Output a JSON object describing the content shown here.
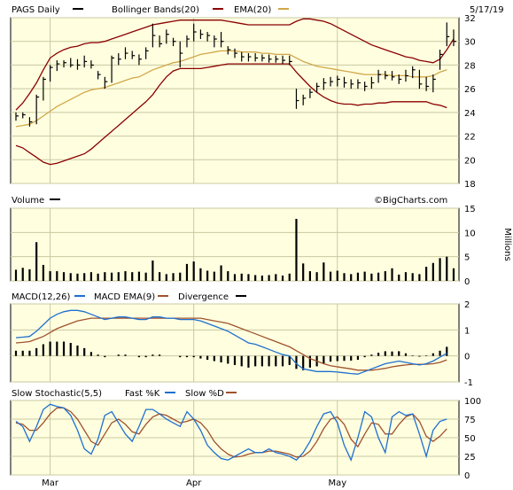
{
  "header": {
    "date": "5/17/19",
    "watermark": "©BigCharts.com"
  },
  "colors": {
    "bg": "#ffffe0",
    "bollinger": "#8b0000",
    "ema": "#d2a648",
    "macd": "#1e6fd0",
    "macd_ema": "#a0522d",
    "fast_k": "#1e6fd0",
    "slow_d": "#a0522d",
    "black": "#000000"
  },
  "x_axis": {
    "labels": [
      "Mar",
      "Apr",
      "May"
    ],
    "label_index": [
      5,
      26,
      47
    ]
  },
  "chart_data": [
    {
      "type": "line",
      "legend": [
        {
          "label": "PAGS Daily",
          "color": "#000000"
        },
        {
          "label": "Bollinger Bands(20)",
          "color": "#8b0000"
        },
        {
          "label": "EMA(20)",
          "color": "#d2a648"
        }
      ],
      "ylim": [
        18,
        32
      ],
      "yticks": [
        18,
        20,
        22,
        24,
        26,
        28,
        30,
        32
      ],
      "price_bars": [
        {
          "h": 24.0,
          "l": 23.3,
          "c": 23.7
        },
        {
          "h": 24.0,
          "l": 23.5,
          "c": 23.8
        },
        {
          "h": 23.6,
          "l": 22.8,
          "c": 23.2
        },
        {
          "h": 25.5,
          "l": 23.0,
          "c": 25.3
        },
        {
          "h": 27.0,
          "l": 25.0,
          "c": 26.8
        },
        {
          "h": 28.0,
          "l": 26.6,
          "c": 27.8
        },
        {
          "h": 28.4,
          "l": 27.5,
          "c": 28.1
        },
        {
          "h": 28.4,
          "l": 27.8,
          "c": 28.2
        },
        {
          "h": 28.6,
          "l": 27.8,
          "c": 28.0
        },
        {
          "h": 28.5,
          "l": 27.6,
          "c": 28.0
        },
        {
          "h": 28.8,
          "l": 27.8,
          "c": 28.3
        },
        {
          "h": 28.4,
          "l": 27.7,
          "c": 28.0
        },
        {
          "h": 27.5,
          "l": 26.8,
          "c": 27.2
        },
        {
          "h": 27.0,
          "l": 26.0,
          "c": 26.6
        },
        {
          "h": 28.8,
          "l": 26.5,
          "c": 28.6
        },
        {
          "h": 29.0,
          "l": 28.0,
          "c": 28.5
        },
        {
          "h": 29.5,
          "l": 28.5,
          "c": 29.0
        },
        {
          "h": 29.2,
          "l": 28.5,
          "c": 28.8
        },
        {
          "h": 28.9,
          "l": 28.0,
          "c": 28.5
        },
        {
          "h": 29.5,
          "l": 28.5,
          "c": 29.2
        },
        {
          "h": 31.5,
          "l": 29.5,
          "c": 30.5
        },
        {
          "h": 30.5,
          "l": 29.5,
          "c": 29.8
        },
        {
          "h": 31.0,
          "l": 29.8,
          "c": 30.6
        },
        {
          "h": 30.3,
          "l": 29.6,
          "c": 30.0
        },
        {
          "h": 30.0,
          "l": 27.8,
          "c": 29.0
        },
        {
          "h": 30.5,
          "l": 29.5,
          "c": 30.2
        },
        {
          "h": 31.5,
          "l": 30.0,
          "c": 30.8
        },
        {
          "h": 31.0,
          "l": 30.2,
          "c": 30.6
        },
        {
          "h": 30.8,
          "l": 30.0,
          "c": 30.5
        },
        {
          "h": 30.5,
          "l": 29.5,
          "c": 30.2
        },
        {
          "h": 30.8,
          "l": 29.5,
          "c": 30.0
        },
        {
          "h": 29.6,
          "l": 28.9,
          "c": 29.3
        },
        {
          "h": 29.4,
          "l": 28.6,
          "c": 29.0
        },
        {
          "h": 29.1,
          "l": 28.3,
          "c": 28.7
        },
        {
          "h": 29.0,
          "l": 28.3,
          "c": 28.7
        },
        {
          "h": 29.0,
          "l": 28.3,
          "c": 28.6
        },
        {
          "h": 28.9,
          "l": 28.3,
          "c": 28.6
        },
        {
          "h": 28.9,
          "l": 28.2,
          "c": 28.5
        },
        {
          "h": 28.8,
          "l": 28.2,
          "c": 28.5
        },
        {
          "h": 28.8,
          "l": 28.1,
          "c": 28.4
        },
        {
          "h": 28.8,
          "l": 28.0,
          "c": 28.3
        },
        {
          "h": 26.0,
          "l": 24.3,
          "c": 25.0
        },
        {
          "h": 25.5,
          "l": 24.6,
          "c": 25.2
        },
        {
          "h": 26.0,
          "l": 25.2,
          "c": 25.7
        },
        {
          "h": 26.5,
          "l": 25.7,
          "c": 26.2
        },
        {
          "h": 26.9,
          "l": 25.9,
          "c": 26.5
        },
        {
          "h": 27.0,
          "l": 26.2,
          "c": 26.6
        },
        {
          "h": 27.1,
          "l": 26.2,
          "c": 26.8
        },
        {
          "h": 27.0,
          "l": 26.1,
          "c": 26.5
        },
        {
          "h": 26.8,
          "l": 26.0,
          "c": 26.4
        },
        {
          "h": 26.8,
          "l": 26.0,
          "c": 26.5
        },
        {
          "h": 26.6,
          "l": 25.8,
          "c": 26.2
        },
        {
          "h": 27.0,
          "l": 26.0,
          "c": 26.5
        },
        {
          "h": 27.6,
          "l": 26.5,
          "c": 27.2
        },
        {
          "h": 27.5,
          "l": 26.8,
          "c": 27.1
        },
        {
          "h": 27.5,
          "l": 26.7,
          "c": 27.0
        },
        {
          "h": 27.2,
          "l": 26.4,
          "c": 26.8
        },
        {
          "h": 27.6,
          "l": 26.6,
          "c": 27.1
        },
        {
          "h": 27.9,
          "l": 26.9,
          "c": 27.6
        },
        {
          "h": 27.6,
          "l": 26.0,
          "c": 26.4
        },
        {
          "h": 27.0,
          "l": 25.8,
          "c": 26.2
        },
        {
          "h": 27.2,
          "l": 25.7,
          "c": 26.8
        },
        {
          "h": 29.3,
          "l": 27.6,
          "c": 28.9
        },
        {
          "h": 31.6,
          "l": 29.6,
          "c": 30.4
        },
        {
          "h": 31.0,
          "l": 29.6,
          "c": 30.0
        }
      ],
      "bollinger_upper": [
        24.2,
        24.8,
        25.6,
        26.5,
        27.6,
        28.6,
        29.0,
        29.3,
        29.5,
        29.6,
        29.8,
        29.9,
        29.9,
        30.0,
        30.2,
        30.4,
        30.6,
        30.8,
        31.0,
        31.2,
        31.4,
        31.5,
        31.6,
        31.7,
        31.8,
        31.8,
        31.8,
        31.8,
        31.8,
        31.8,
        31.8,
        31.7,
        31.6,
        31.5,
        31.4,
        31.4,
        31.4,
        31.4,
        31.4,
        31.4,
        31.4,
        31.7,
        31.9,
        31.9,
        31.8,
        31.7,
        31.5,
        31.2,
        30.9,
        30.6,
        30.3,
        30.0,
        29.7,
        29.5,
        29.3,
        29.1,
        28.9,
        28.7,
        28.6,
        28.4,
        28.3,
        28.2,
        28.5,
        29.3,
        30.2
      ],
      "bollinger_lower": [
        21.2,
        21.0,
        20.6,
        20.2,
        19.8,
        19.6,
        19.7,
        19.9,
        20.1,
        20.3,
        20.5,
        20.9,
        21.4,
        21.9,
        22.4,
        22.9,
        23.4,
        23.9,
        24.4,
        24.9,
        25.5,
        26.3,
        27.0,
        27.5,
        27.7,
        27.7,
        27.7,
        27.7,
        27.8,
        27.9,
        28.0,
        28.1,
        28.1,
        28.1,
        28.1,
        28.1,
        28.1,
        28.1,
        28.1,
        28.1,
        28.1,
        27.4,
        26.8,
        26.2,
        25.7,
        25.3,
        25.0,
        24.8,
        24.7,
        24.7,
        24.6,
        24.7,
        24.7,
        24.8,
        24.8,
        24.9,
        24.9,
        24.9,
        24.9,
        24.9,
        24.9,
        24.7,
        24.6,
        24.4
      ],
      "ema": [
        22.8,
        22.9,
        23.0,
        23.3,
        23.7,
        24.1,
        24.5,
        24.8,
        25.1,
        25.4,
        25.7,
        25.9,
        26.0,
        26.1,
        26.3,
        26.5,
        26.7,
        26.9,
        27.0,
        27.3,
        27.6,
        27.8,
        28.0,
        28.2,
        28.3,
        28.5,
        28.7,
        28.9,
        29.0,
        29.1,
        29.2,
        29.2,
        29.2,
        29.1,
        29.1,
        29.1,
        29.0,
        29.0,
        28.9,
        28.9,
        28.9,
        28.6,
        28.3,
        28.1,
        27.9,
        27.8,
        27.7,
        27.6,
        27.5,
        27.4,
        27.3,
        27.2,
        27.2,
        27.2,
        27.2,
        27.1,
        27.1,
        27.1,
        27.0,
        27.0,
        27.0,
        27.1,
        27.4,
        27.6
      ]
    },
    {
      "type": "bar",
      "legend": [
        {
          "label": "Volume",
          "color": "#000000"
        }
      ],
      "ylabel": "Millions",
      "ylim": [
        0,
        15
      ],
      "yticks": [
        0,
        5,
        10,
        15
      ],
      "values": [
        2.3,
        2.7,
        2.4,
        8.0,
        3.3,
        2.0,
        2.0,
        1.8,
        1.6,
        1.5,
        1.6,
        1.8,
        1.5,
        1.8,
        1.7,
        1.8,
        2.0,
        1.8,
        1.9,
        1.7,
        4.2,
        1.8,
        1.4,
        1.6,
        1.7,
        3.5,
        4.0,
        2.6,
        2.1,
        1.9,
        3.2,
        2.0,
        1.4,
        1.5,
        1.4,
        1.2,
        1.1,
        1.2,
        1.4,
        1.1,
        1.5,
        12.8,
        3.6,
        2.0,
        1.8,
        3.8,
        1.9,
        2.1,
        1.6,
        1.4,
        1.7,
        1.9,
        1.5,
        1.7,
        2.0,
        2.6,
        1.3,
        1.8,
        1.6,
        1.4,
        2.9,
        3.7,
        4.7,
        5.0,
        2.6
      ]
    },
    {
      "type": "line",
      "legend": [
        {
          "label": "MACD(12,26)",
          "color": "#1e6fd0"
        },
        {
          "label": "MACD EMA(9)",
          "color": "#a0522d"
        },
        {
          "label": "Divergence",
          "color": "#000000"
        }
      ],
      "ylim": [
        -1,
        2
      ],
      "yticks": [
        -1,
        0,
        1,
        2
      ],
      "macd": [
        0.7,
        0.72,
        0.75,
        0.95,
        1.2,
        1.45,
        1.6,
        1.7,
        1.75,
        1.75,
        1.7,
        1.6,
        1.5,
        1.4,
        1.45,
        1.5,
        1.5,
        1.45,
        1.4,
        1.4,
        1.5,
        1.5,
        1.45,
        1.45,
        1.4,
        1.4,
        1.4,
        1.35,
        1.25,
        1.15,
        1.05,
        0.95,
        0.8,
        0.65,
        0.5,
        0.45,
        0.35,
        0.25,
        0.15,
        0.05,
        0.0,
        -0.3,
        -0.5,
        -0.55,
        -0.6,
        -0.6,
        -0.6,
        -0.62,
        -0.65,
        -0.68,
        -0.7,
        -0.6,
        -0.5,
        -0.4,
        -0.3,
        -0.25,
        -0.2,
        -0.25,
        -0.3,
        -0.35,
        -0.3,
        -0.2,
        -0.05,
        0.1
      ],
      "signal": [
        0.5,
        0.52,
        0.55,
        0.65,
        0.75,
        0.9,
        1.05,
        1.15,
        1.25,
        1.35,
        1.4,
        1.45,
        1.45,
        1.45,
        1.45,
        1.45,
        1.45,
        1.45,
        1.45,
        1.45,
        1.45,
        1.45,
        1.45,
        1.45,
        1.45,
        1.45,
        1.45,
        1.45,
        1.4,
        1.35,
        1.3,
        1.25,
        1.15,
        1.05,
        0.95,
        0.85,
        0.75,
        0.65,
        0.55,
        0.45,
        0.35,
        0.2,
        0.05,
        -0.1,
        -0.2,
        -0.3,
        -0.38,
        -0.42,
        -0.46,
        -0.5,
        -0.55,
        -0.55,
        -0.55,
        -0.52,
        -0.48,
        -0.42,
        -0.38,
        -0.35,
        -0.32,
        -0.32,
        -0.32,
        -0.3,
        -0.25,
        -0.15
      ],
      "divergence": [
        0.2,
        0.2,
        0.2,
        0.3,
        0.45,
        0.55,
        0.55,
        0.55,
        0.5,
        0.4,
        0.3,
        0.15,
        0.05,
        -0.05,
        0.0,
        0.05,
        0.05,
        0.0,
        -0.05,
        -0.05,
        0.05,
        0.05,
        0.0,
        0.0,
        -0.05,
        -0.05,
        -0.05,
        -0.1,
        -0.15,
        -0.2,
        -0.25,
        -0.3,
        -0.35,
        -0.4,
        -0.45,
        -0.4,
        -0.4,
        -0.4,
        -0.4,
        -0.4,
        -0.35,
        -0.5,
        -0.55,
        -0.45,
        -0.4,
        -0.3,
        -0.22,
        -0.2,
        -0.19,
        -0.18,
        -0.15,
        -0.05,
        0.05,
        0.12,
        0.18,
        0.17,
        0.18,
        0.1,
        0.02,
        -0.03,
        0.02,
        0.1,
        0.2,
        0.35
      ]
    },
    {
      "type": "line",
      "legend": [
        {
          "label": "Slow Stochastic(5,5)",
          "color": "#000000"
        },
        {
          "label": "Fast %K",
          "color": "#1e6fd0"
        },
        {
          "label": "Slow %D",
          "color": "#a0522d"
        }
      ],
      "ylim": [
        0,
        100
      ],
      "yticks": [
        0,
        25,
        50,
        75,
        100
      ],
      "fast_k": [
        72,
        65,
        45,
        65,
        88,
        95,
        92,
        90,
        80,
        60,
        35,
        28,
        48,
        80,
        85,
        70,
        55,
        45,
        65,
        88,
        88,
        82,
        75,
        70,
        65,
        85,
        75,
        60,
        40,
        30,
        22,
        20,
        25,
        30,
        35,
        30,
        30,
        35,
        30,
        28,
        25,
        20,
        30,
        45,
        65,
        82,
        85,
        70,
        40,
        20,
        50,
        85,
        78,
        50,
        30,
        78,
        85,
        80,
        82,
        55,
        25,
        60,
        72,
        75
      ],
      "slow_d": [
        70,
        68,
        60,
        60,
        70,
        82,
        90,
        90,
        85,
        75,
        60,
        45,
        40,
        55,
        70,
        75,
        68,
        58,
        55,
        68,
        78,
        82,
        80,
        75,
        70,
        72,
        75,
        70,
        60,
        45,
        35,
        28,
        24,
        25,
        28,
        30,
        30,
        32,
        32,
        30,
        28,
        24,
        25,
        32,
        45,
        62,
        75,
        78,
        68,
        48,
        38,
        55,
        70,
        68,
        55,
        55,
        68,
        78,
        82,
        72,
        52,
        45,
        52,
        62
      ]
    }
  ]
}
